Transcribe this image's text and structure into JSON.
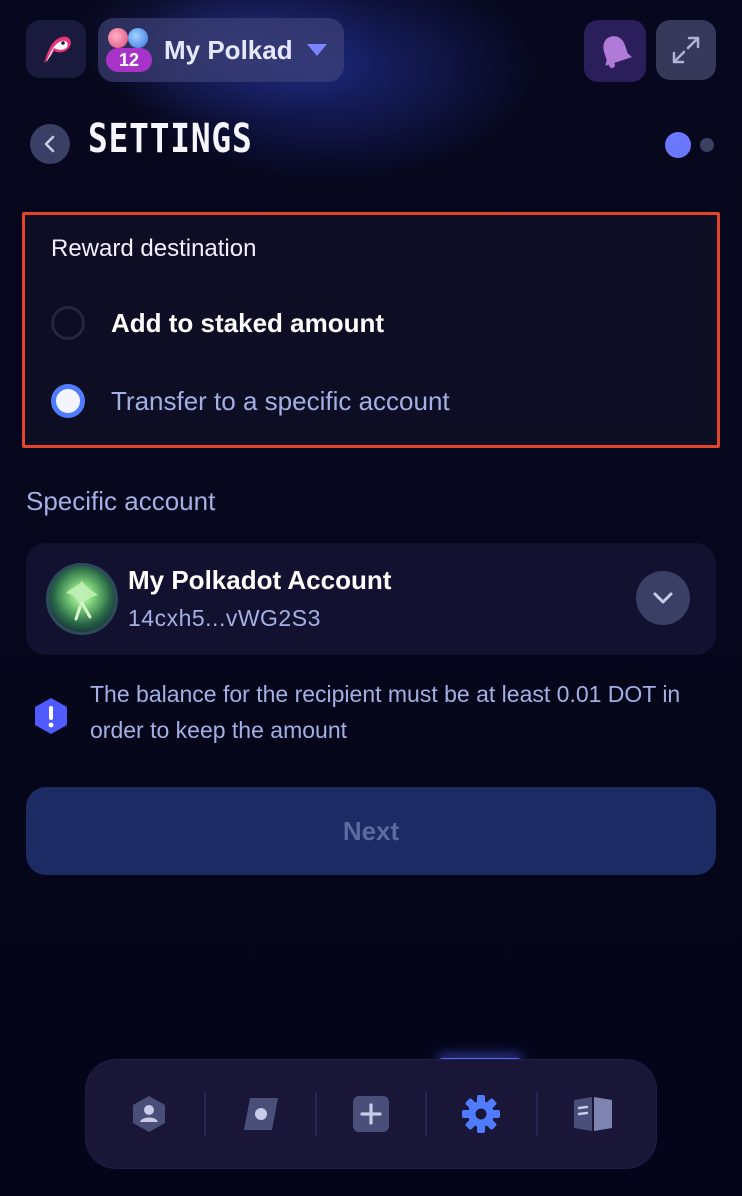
{
  "header": {
    "account_name": "My Polkad",
    "account_count": "12"
  },
  "page": {
    "title": "SETTINGS",
    "steps_total": 2,
    "step_current": 1
  },
  "reward": {
    "label": "Reward destination",
    "options": [
      {
        "label": "Add to staked amount",
        "selected": false
      },
      {
        "label": "Transfer to a specific account",
        "selected": true
      }
    ]
  },
  "specific": {
    "label": "Specific account",
    "account_name": "My Polkadot Account",
    "account_address": "14cxh5...vWG2S3"
  },
  "warning": {
    "text": "The balance for the recipient must be at least 0.01 DOT in order to keep the amount"
  },
  "actions": {
    "next_label": "Next"
  },
  "nav": {
    "items": [
      "accounts-icon",
      "explore-icon",
      "add-icon",
      "settings-icon",
      "docs-icon"
    ],
    "active": "settings-icon"
  },
  "colors": {
    "accent": "#4f7cff",
    "highlight_border": "#e5432b"
  }
}
